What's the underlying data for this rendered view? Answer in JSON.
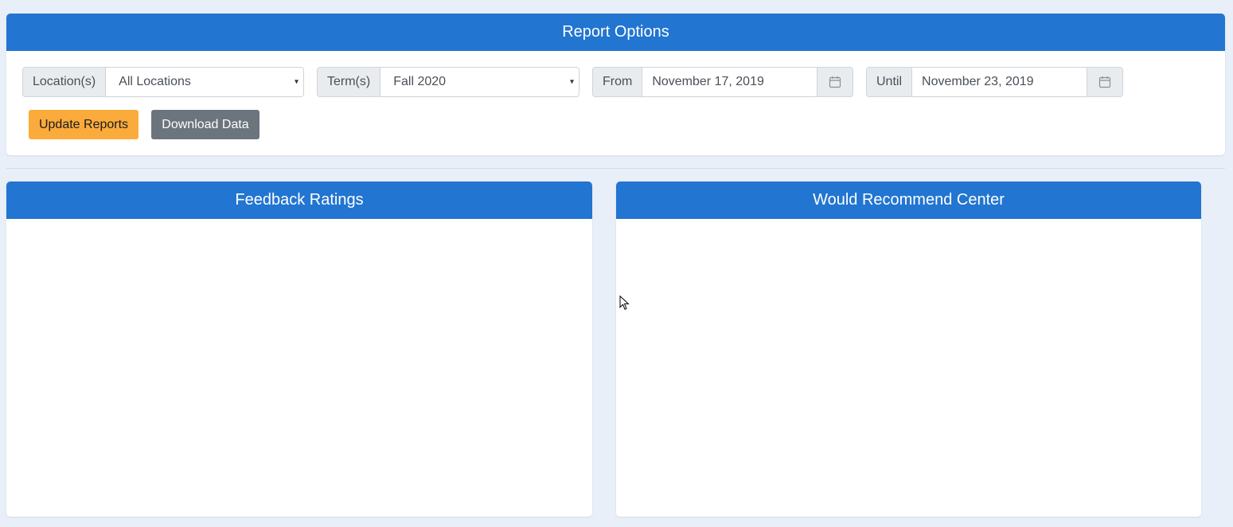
{
  "report_options": {
    "title": "Report Options",
    "location": {
      "label": "Location(s)",
      "value": "All Locations"
    },
    "term": {
      "label": "Term(s)",
      "value": "Fall 2020"
    },
    "from": {
      "label": "From",
      "value": "November 17, 2019"
    },
    "until": {
      "label": "Until",
      "value": "November 23, 2019"
    },
    "buttons": {
      "update": "Update Reports",
      "download": "Download Data"
    },
    "caret": "▾"
  },
  "panels": {
    "feedback": {
      "title": "Feedback Ratings"
    },
    "recommend": {
      "title": "Would Recommend Center"
    }
  },
  "colors": {
    "header_blue": "#2275d0",
    "update_orange": "#fbab3b",
    "download_gray": "#6c757d",
    "page_bg": "#e9eff8"
  },
  "icons": [
    "calendar-icon",
    "mouse-cursor-icon"
  ]
}
